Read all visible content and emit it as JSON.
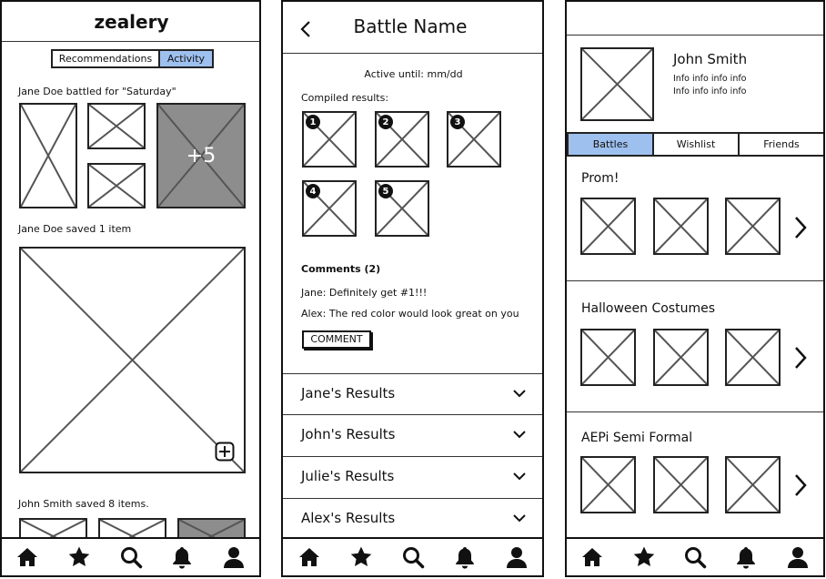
{
  "screen1": {
    "app_title": "zealery",
    "tabs": [
      "Recommendations",
      "Activity"
    ],
    "active_tab": "Activity",
    "feed": [
      {
        "text": "Jane Doe battled for \"Saturday\"",
        "more_count": "+5"
      },
      {
        "text": "Jane Doe saved 1 item",
        "action": "add-icon"
      },
      {
        "text": "John Smith saved 8 items."
      }
    ]
  },
  "screen2": {
    "title": "Battle Name",
    "active_until": "Active until: mm/dd",
    "compiled_label": "Compiled results:",
    "ranks": [
      "1",
      "2",
      "3",
      "4",
      "5"
    ],
    "comments_header": "Comments (2)",
    "comments": [
      "Jane: Definitely get #1!!!",
      "Alex: The red color would look great on you"
    ],
    "comment_button": "COMMENT",
    "results": [
      "Jane's Results",
      "John's Results",
      "Julie's Results",
      "Alex's Results"
    ]
  },
  "screen3": {
    "profile_name": "John Smith",
    "profile_info": [
      "Info info info info",
      "Info info info info"
    ],
    "tabs": [
      "Battles",
      "Wishlist",
      "Friends"
    ],
    "active_tab": "Battles",
    "battles": [
      "Prom!",
      "Halloween Costumes",
      "AEPi Semi Formal"
    ]
  },
  "navbar_icons": [
    "home-icon",
    "star-icon",
    "search-icon",
    "bell-icon",
    "user-icon"
  ],
  "colors": {
    "accent": "#9ec0ee",
    "placeholder_gray": "#8d8d8d",
    "stroke": "#222222"
  }
}
